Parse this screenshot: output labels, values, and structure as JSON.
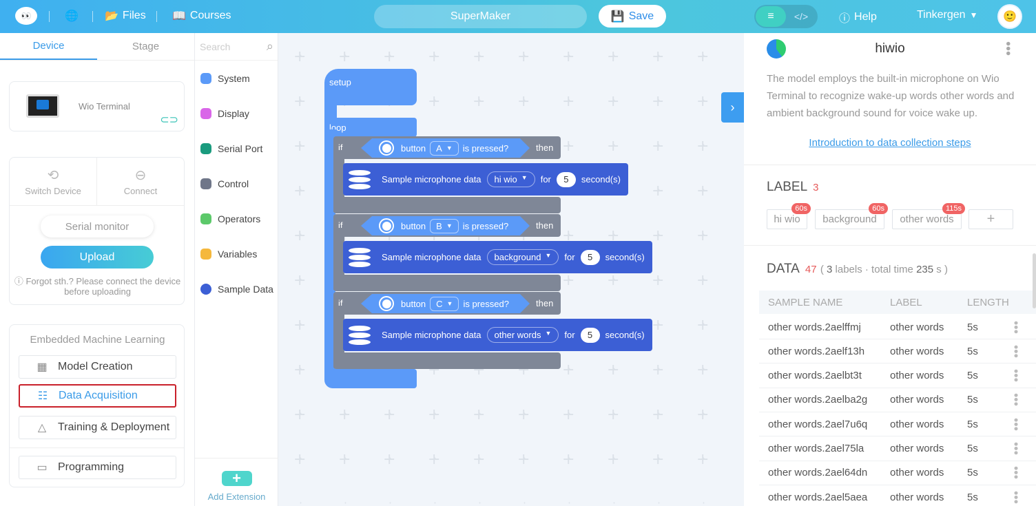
{
  "topbar": {
    "files": "Files",
    "courses": "Courses",
    "project_name": "SuperMaker",
    "save": "Save",
    "help": "Help",
    "user": "Tinkergen"
  },
  "left": {
    "tabs": [
      "Device",
      "Stage"
    ],
    "device_name": "Wio Terminal",
    "switch_device": "Switch Device",
    "connect": "Connect",
    "serial_monitor": "Serial monitor",
    "upload": "Upload",
    "hint": "Forgot sth.? Please connect the device before uploading",
    "ml_title": "Embedded Machine Learning",
    "ml_items": [
      "Model Creation",
      "Data Acquisition",
      "Training & Deployment"
    ],
    "programming": "Programming"
  },
  "categories": {
    "search_placeholder": "Search",
    "items": [
      {
        "label": "System",
        "color": "#5b9af8"
      },
      {
        "label": "Display",
        "color": "#d966e8"
      },
      {
        "label": "Serial Port",
        "color": "#1a9b7e"
      },
      {
        "label": "Control",
        "color": "#6f7689"
      },
      {
        "label": "Operators",
        "color": "#5cc96a"
      },
      {
        "label": "Variables",
        "color": "#f5b83c"
      },
      {
        "label": "Sample Data",
        "color": "#3c5fd5"
      }
    ],
    "add_extension": "Add Extension"
  },
  "blocks": {
    "setup": "setup",
    "loop": "loop",
    "if": "if",
    "button": "button",
    "is_pressed": "is pressed?",
    "then": "then",
    "sample": "Sample microphone data",
    "for": "for",
    "seconds": "second(s)",
    "groups": [
      {
        "button": "A",
        "label": "hi wio",
        "duration": "5"
      },
      {
        "button": "B",
        "label": "background",
        "duration": "5"
      },
      {
        "button": "C",
        "label": "other words",
        "duration": "5"
      }
    ]
  },
  "right": {
    "model_name": "hiwio",
    "description": "The model employs the built-in microphone on Wio Terminal to recognize wake-up words other words and ambient background sound for voice wake up.",
    "intro_link": "Introduction to data collection steps",
    "label_title": "LABEL",
    "label_count": "3",
    "labels": [
      {
        "name": "hi wio",
        "time": "60s"
      },
      {
        "name": "background",
        "time": "60s"
      },
      {
        "name": "other words",
        "time": "115s"
      }
    ],
    "add_label": "+",
    "data_title": "DATA",
    "data_count": "47",
    "data_summary_a": "(",
    "data_labels_num": "3",
    "data_summary_b": "labels · total time",
    "data_total": "235",
    "data_summary_c": "s )",
    "columns": [
      "SAMPLE NAME",
      "LABEL",
      "LENGTH"
    ],
    "rows": [
      {
        "name": "other words.2aelffmj",
        "label": "other words",
        "length": "5s"
      },
      {
        "name": "other words.2aelf13h",
        "label": "other words",
        "length": "5s"
      },
      {
        "name": "other words.2aelbt3t",
        "label": "other words",
        "length": "5s"
      },
      {
        "name": "other words.2aelba2g",
        "label": "other words",
        "length": "5s"
      },
      {
        "name": "other words.2ael7u6q",
        "label": "other words",
        "length": "5s"
      },
      {
        "name": "other words.2ael75la",
        "label": "other words",
        "length": "5s"
      },
      {
        "name": "other words.2ael64dn",
        "label": "other words",
        "length": "5s"
      },
      {
        "name": "other words.2ael5aea",
        "label": "other words",
        "length": "5s"
      }
    ]
  }
}
